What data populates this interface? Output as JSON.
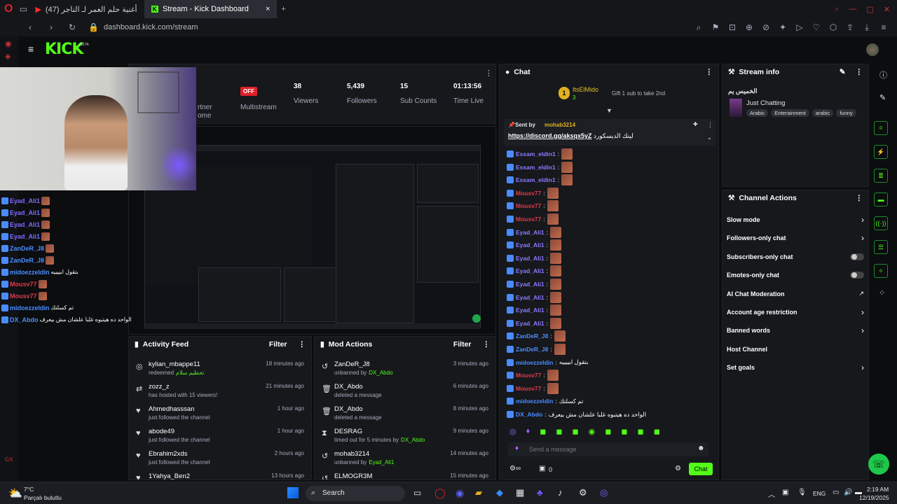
{
  "browser": {
    "tabs": [
      {
        "label": "(47) أغنية حلم العمر لـ الناجر"
      },
      {
        "label": "Stream - Kick Dashboard"
      }
    ],
    "url": "dashboard.kick.com/stream"
  },
  "header": {
    "logo": "KICK",
    "beta": "BETA"
  },
  "stream_stats": {
    "partner_line1": "rtner",
    "partner_line2": "ome",
    "multistream_badge": "OFF",
    "multistream_label": "Multistream",
    "viewers_value": "38",
    "viewers_label": "Viewers",
    "followers_value": "5,439",
    "followers_label": "Followers",
    "subs_value": "15",
    "subs_label": "Sub Counts",
    "time_value": "01:13:56",
    "time_label": "Time Live"
  },
  "overlay_chat": [
    {
      "user": "Eyad_Ali1",
      "msg": "",
      "color": "#7b6cff"
    },
    {
      "user": "Eyad_Ali1",
      "msg": "",
      "color": "#7b6cff"
    },
    {
      "user": "Eyad_Ali1",
      "msg": "",
      "color": "#7b6cff"
    },
    {
      "user": "Eyad_Ali1",
      "msg": "",
      "color": "#7b6cff"
    },
    {
      "user": "ZanDeR_J8",
      "msg": "",
      "color": "#4a8cff"
    },
    {
      "user": "ZanDeR_J8",
      "msg": "",
      "color": "#4a8cff"
    },
    {
      "user": "midoezzeldin",
      "msg": "بتقول ابييييه",
      "color": "#4a8cff"
    },
    {
      "user": "Mousv77",
      "msg": "",
      "color": "#e03a4a"
    },
    {
      "user": "Mousv77",
      "msg": "",
      "color": "#e03a4a"
    },
    {
      "user": "midoezzeldin",
      "msg": "تم كسلتك",
      "color": "#4a8cff"
    },
    {
      "user": "DX_Abdo",
      "msg": "الواحد ده هيتبوه غلبا علشان مش بيعرف",
      "color": "#4a8cff"
    }
  ],
  "activity_feed": {
    "title": "Activity Feed",
    "filter": "Filter",
    "items": [
      {
        "icon": "gift-icon",
        "glyph": "◎",
        "name": "kylian_mbappe11",
        "desc": "redeemed",
        "extra": "تحطيم سلام",
        "time": "18 minutes ago"
      },
      {
        "icon": "host-icon",
        "glyph": "⇄",
        "name": "zozz_z",
        "desc": "has hosted with 15 viewers!",
        "extra": "",
        "time": "21 minutes ago"
      },
      {
        "icon": "heart-icon",
        "glyph": "♥",
        "name": "Ahmedhasssan",
        "desc": "just followed the channel",
        "extra": "",
        "time": "1 hour ago"
      },
      {
        "icon": "heart-icon",
        "glyph": "♥",
        "name": "abode49",
        "desc": "just followed the channel",
        "extra": "",
        "time": "1 hour ago"
      },
      {
        "icon": "heart-icon",
        "glyph": "♥",
        "name": "Ebrahim2xds",
        "desc": "just followed the channel",
        "extra": "",
        "time": "2 hours ago"
      },
      {
        "icon": "heart-icon",
        "glyph": "♥",
        "name": "1Yahya_Ben2",
        "desc": "",
        "extra": "",
        "time": "13 hours ago"
      }
    ]
  },
  "mod_actions": {
    "title": "Mod Actions",
    "filter": "Filter",
    "items": [
      {
        "icon": "undo-icon",
        "glyph": "↺",
        "name": "ZanDeR_J8",
        "desc": "unbanned by",
        "by": "DX_Abdo",
        "time": "3 minutes ago"
      },
      {
        "icon": "trash-icon",
        "glyph": "🗑",
        "name": "DX_Abdo",
        "desc": "deleted a message",
        "by": "",
        "time": "6 minutes ago"
      },
      {
        "icon": "trash-icon",
        "glyph": "🗑",
        "name": "DX_Abdo",
        "desc": "deleted a message",
        "by": "",
        "time": "8 minutes ago"
      },
      {
        "icon": "hourglass-icon",
        "glyph": "⧗",
        "name": "DESRAG",
        "desc": "timed out for 5 minutes by",
        "by": "DX_Abdo",
        "time": "9 minutes ago"
      },
      {
        "icon": "undo-icon",
        "glyph": "↺",
        "name": "mohab3214",
        "desc": "unbanned by",
        "by": "Eyad_Ali1",
        "time": "14 minutes ago"
      },
      {
        "icon": "undo-icon",
        "glyph": "↺",
        "name": "ELMOGR3M",
        "desc": "",
        "by": "",
        "time": "15 minutes ago"
      }
    ]
  },
  "chat": {
    "title": "Chat",
    "top_gifter": "ItsElMido",
    "top_gifter_count": "3",
    "gift_hint": "Gift 1 sub to take 2nd",
    "pinned_sent_by": "Sent by",
    "pinned_user": "mohab3214",
    "pinned_link": "https://discord.gg/aksqx5yZ",
    "pinned_text": "لينك الديسكورد",
    "messages": [
      {
        "user": "Essam_eldin1",
        "msg": "",
        "color": "#8a7cff",
        "emote": true
      },
      {
        "user": "Essam_eldin1",
        "msg": "",
        "color": "#8a7cff",
        "emote": true
      },
      {
        "user": "Essam_eldin1",
        "msg": "",
        "color": "#8a7cff",
        "emote": true
      },
      {
        "user": "Mousv77",
        "msg": "",
        "color": "#e03a4a",
        "emote": true
      },
      {
        "user": "Mousv77",
        "msg": "",
        "color": "#e03a4a",
        "emote": true
      },
      {
        "user": "Mousv77",
        "msg": "",
        "color": "#e03a4a",
        "emote": true
      },
      {
        "user": "Eyad_Ali1",
        "msg": "",
        "color": "#8a7cff",
        "emote": true
      },
      {
        "user": "Eyad_Ali1",
        "msg": "",
        "color": "#8a7cff",
        "emote": true
      },
      {
        "user": "Eyad_Ali1",
        "msg": "",
        "color": "#8a7cff",
        "emote": true
      },
      {
        "user": "Eyad_Ali1",
        "msg": "",
        "color": "#8a7cff",
        "emote": true
      },
      {
        "user": "Eyad_Ali1",
        "msg": "",
        "color": "#8a7cff",
        "emote": true
      },
      {
        "user": "Eyad_Ali1",
        "msg": "",
        "color": "#8a7cff",
        "emote": true
      },
      {
        "user": "Eyad_Ali1",
        "msg": "",
        "color": "#8a7cff",
        "emote": true
      },
      {
        "user": "Eyad_Ali1",
        "msg": "",
        "color": "#8a7cff",
        "emote": true
      },
      {
        "user": "ZanDeR_J8",
        "msg": "",
        "color": "#4a8cff",
        "emote": true
      },
      {
        "user": "ZanDeR_J8",
        "msg": "",
        "color": "#4a8cff",
        "emote": true
      },
      {
        "user": "midoezzeldin",
        "msg": "بتقول ابييييه",
        "color": "#4a8cff",
        "emote": false
      },
      {
        "user": "Mousv77",
        "msg": "",
        "color": "#e03a4a",
        "emote": true
      },
      {
        "user": "Mousv77",
        "msg": "",
        "color": "#e03a4a",
        "emote": true
      },
      {
        "user": "midoezzeldin",
        "msg": "تم كسلتك",
        "color": "#4a8cff",
        "emote": false
      },
      {
        "user": "DX_Abdo",
        "msg": "الواحد ده هيتبوه غلبا علشان مش بيعرف",
        "color": "#4a8cff",
        "emote": false
      }
    ],
    "placeholder": "Send a message",
    "points": "0",
    "send_label": "Chat"
  },
  "stream_info": {
    "title": "Stream info",
    "stream_title": "الخميس يم",
    "category": "Just Chatting",
    "tags": [
      "Arabic",
      "Enterainment",
      "arabic",
      "funny"
    ]
  },
  "channel_actions": {
    "title": "Channel Actions",
    "items": [
      {
        "label": "Slow mode",
        "control": "chevron"
      },
      {
        "label": "Followers-only chat",
        "control": "chevron"
      },
      {
        "label": "Subscribers-only chat",
        "control": "toggle"
      },
      {
        "label": "Emotes-only chat",
        "control": "toggle"
      },
      {
        "label": "AI Chat Moderation",
        "control": "external"
      },
      {
        "label": "Account age restriction",
        "control": "chevron"
      },
      {
        "label": "Banned words",
        "control": "chevron"
      },
      {
        "label": "Host Channel",
        "control": "none"
      },
      {
        "label": "Set goals",
        "control": "chevron"
      }
    ]
  },
  "taskbar": {
    "weather_temp": "7°C",
    "weather_desc": "Parçalı bulutlu",
    "search": "Search",
    "lang": "ENG",
    "time": "2:19 AM",
    "date": "12/19/2025"
  }
}
